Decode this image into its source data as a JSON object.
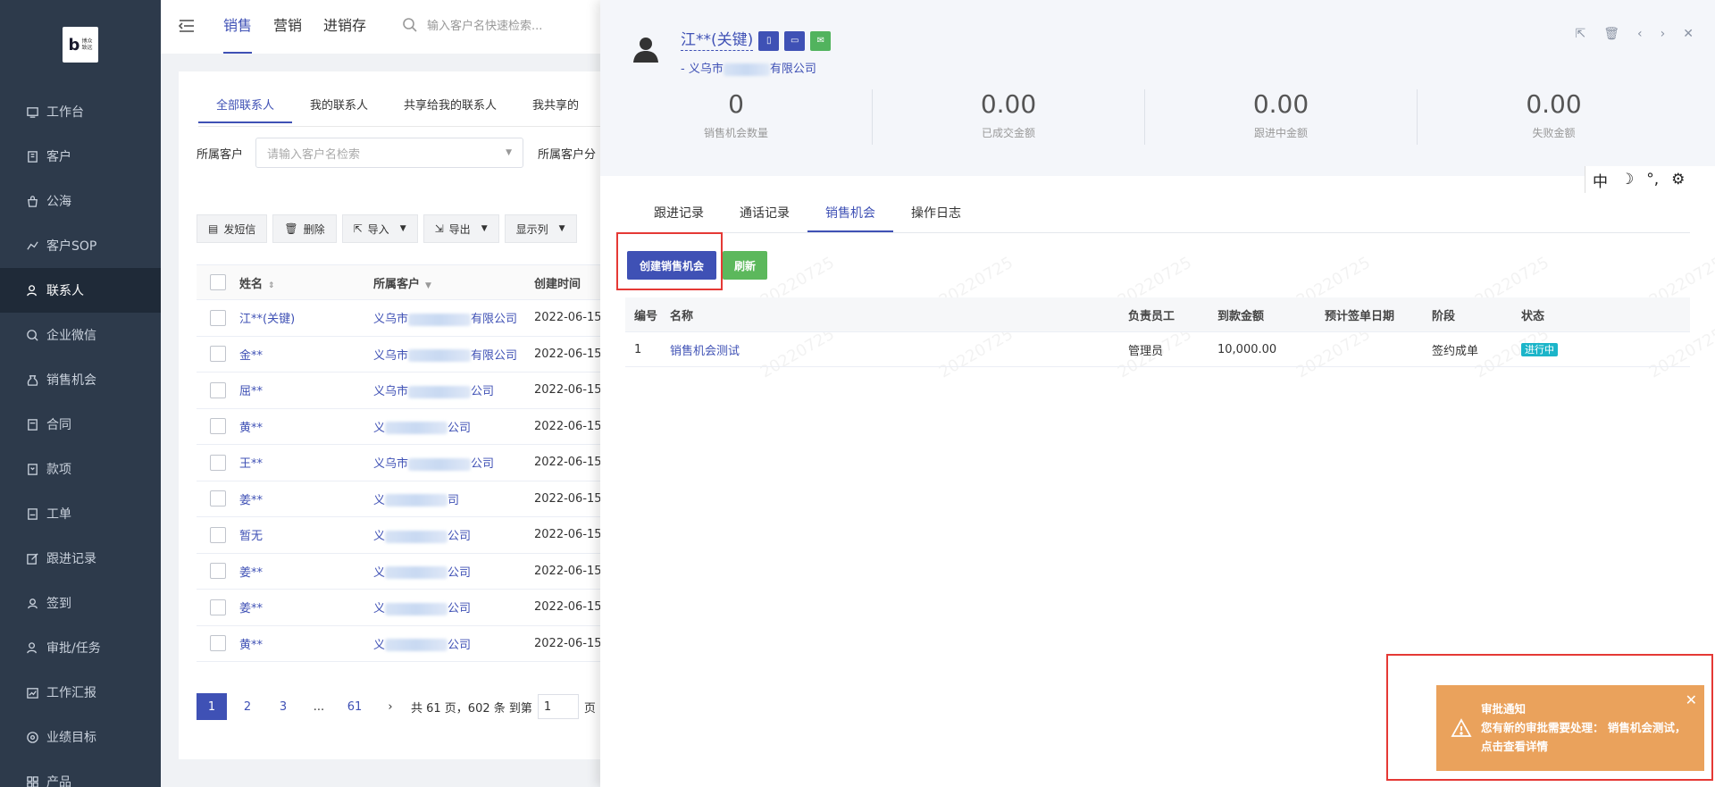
{
  "logo": {
    "letter": "b",
    "text": "博众\n致远"
  },
  "sidebar": {
    "items": [
      {
        "label": "工作台",
        "icon": "monitor-icon"
      },
      {
        "label": "客户",
        "icon": "building-icon"
      },
      {
        "label": "公海",
        "icon": "bag-icon"
      },
      {
        "label": "客户SOP",
        "icon": "sop-icon"
      },
      {
        "label": "联系人",
        "icon": "contacts-icon",
        "active": true
      },
      {
        "label": "企业微信",
        "icon": "wechat-icon"
      },
      {
        "label": "销售机会",
        "icon": "moneybag-icon"
      },
      {
        "label": "合同",
        "icon": "contract-icon"
      },
      {
        "label": "款项",
        "icon": "payment-icon"
      },
      {
        "label": "工单",
        "icon": "ticket-icon"
      },
      {
        "label": "跟进记录",
        "icon": "edit-icon"
      },
      {
        "label": "签到",
        "icon": "checkin-icon"
      },
      {
        "label": "审批/任务",
        "icon": "approval-icon"
      },
      {
        "label": "工作汇报",
        "icon": "report-icon"
      },
      {
        "label": "业绩目标",
        "icon": "target-icon"
      },
      {
        "label": "产品",
        "icon": "product-icon"
      }
    ]
  },
  "topbar": {
    "tabs": [
      "销售",
      "营销",
      "进销存"
    ],
    "search_placeholder": "输入客户名快速检索..."
  },
  "list": {
    "tabs": [
      "全部联系人",
      "我的联系人",
      "共享给我的联系人",
      "我共享的"
    ],
    "filter_label": "所属客户",
    "filter_placeholder": "请输入客户名检索",
    "filter_label2": "所属客户分",
    "toolbar": {
      "sms": "发短信",
      "delete": "删除",
      "import": "导入",
      "export": "导出",
      "columns": "显示列"
    },
    "columns": [
      "姓名",
      "所属客户",
      "创建时间"
    ],
    "rows": [
      {
        "name": "江**(关键)",
        "cust_a": "义乌市",
        "cust_b": "有限公司",
        "time": "2022-06-15"
      },
      {
        "name": "金**",
        "cust_a": "义乌市",
        "cust_b": "有限公司",
        "time": "2022-06-15"
      },
      {
        "name": "屈**",
        "cust_a": "义乌市",
        "cust_b": "公司",
        "time": "2022-06-15"
      },
      {
        "name": "黄**",
        "cust_a": "义",
        "cust_b": "公司",
        "time": "2022-06-15"
      },
      {
        "name": "王**",
        "cust_a": "义乌市",
        "cust_b": "公司",
        "time": "2022-06-15"
      },
      {
        "name": "姜**",
        "cust_a": "义",
        "cust_b": "司",
        "time": "2022-06-15"
      },
      {
        "name": "暂无",
        "cust_a": "义",
        "cust_b": "公司",
        "time": "2022-06-15"
      },
      {
        "name": "姜**",
        "cust_a": "义",
        "cust_b": "公司",
        "time": "2022-06-15"
      },
      {
        "name": "姜**",
        "cust_a": "义",
        "cust_b": "公司",
        "time": "2022-06-15"
      },
      {
        "name": "黄**",
        "cust_a": "义",
        "cust_b": "公司",
        "time": "2022-06-15"
      }
    ],
    "pager": {
      "pages": [
        "1",
        "2",
        "3",
        "...",
        "61"
      ],
      "summary": "共 61 页，602 条 到第",
      "goto": "1",
      "suffix": "页"
    }
  },
  "drawer": {
    "contact_name": "江**(关键)",
    "company": "- 义乌市",
    "company_tail": "有限公司",
    "stats": [
      {
        "value": "0",
        "label": "销售机会数量"
      },
      {
        "value": "0.00",
        "label": "已成交金额"
      },
      {
        "value": "0.00",
        "label": "跟进中金额"
      },
      {
        "value": "0.00",
        "label": "失败金额"
      }
    ],
    "ime": {
      "lang": "中",
      "punct": "°,"
    },
    "tabs": [
      "跟进记录",
      "通话记录",
      "销售机会",
      "操作日志"
    ],
    "create_btn": "创建销售机会",
    "refresh_btn": "刷新",
    "watermark": "20220725",
    "table": {
      "columns": [
        "编号",
        "名称",
        "负责员工",
        "到款金额",
        "预计签单日期",
        "阶段",
        "状态"
      ],
      "rows": [
        {
          "no": "1",
          "name": "销售机会测试",
          "employee": "管理员",
          "amount": "10,000.00",
          "date": "",
          "stage": "签约成单",
          "status": "进行中"
        }
      ]
    }
  },
  "notice": {
    "title": "审批通知",
    "body": "您有新的审批需要处理：  销售机会测试，点击查看详情"
  },
  "colors": {
    "sidebar": "#2d3a4b",
    "accent": "#3f51b5",
    "refresh": "#5cb85c",
    "notice": "#eaa25c",
    "status": "#1cb5c9",
    "highlight": "#e53935"
  }
}
